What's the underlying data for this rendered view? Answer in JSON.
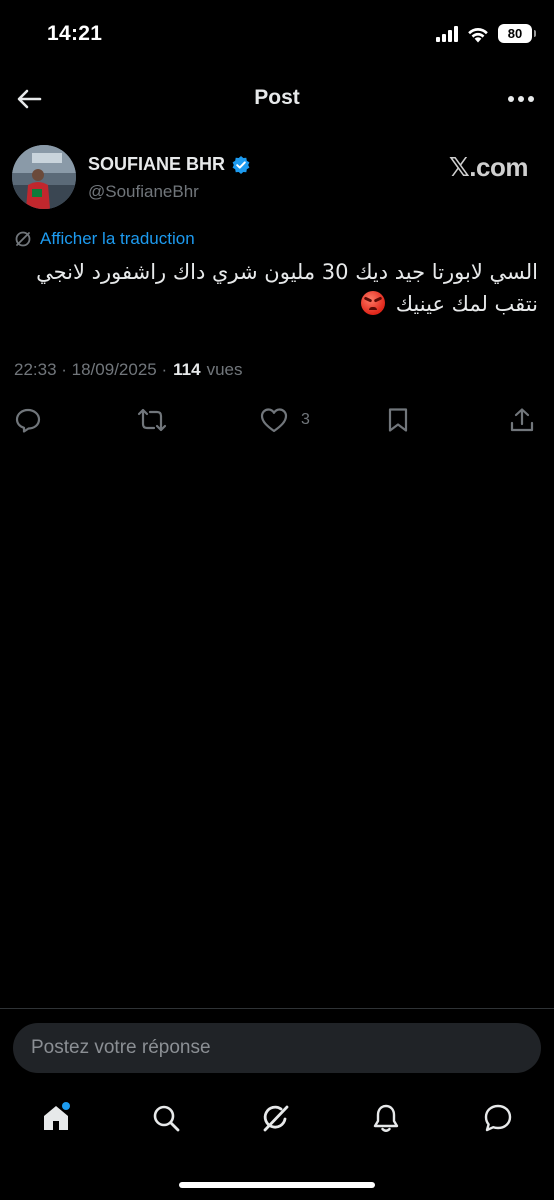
{
  "status_bar": {
    "time": "14:21",
    "battery": "80"
  },
  "header": {
    "title": "Post"
  },
  "post": {
    "author_name": "SOUFIANE BHR",
    "author_handle": "@SoufianeBhr",
    "watermark": "𝕏.com",
    "translate_label": "Afficher la traduction",
    "text_line1": "السي لابورتا جيد ديك 30 مليون شري داك راشفورد لانجي",
    "text_line2": "نتقب لمك عينيك",
    "emoji_icon": "enraged-face-emoji",
    "timestamp": "22:33 · 18/09/2025 ·",
    "views_count": "114",
    "views_label": "vues",
    "like_count": "3"
  },
  "reply": {
    "placeholder": "Postez votre réponse"
  },
  "colors": {
    "accent": "#1d9bf0",
    "background": "#000000",
    "muted": "#71767b",
    "text": "#e7e9ea"
  },
  "nav_icons": [
    "home-icon",
    "search-icon",
    "grok-icon",
    "notifications-icon",
    "messages-icon"
  ]
}
